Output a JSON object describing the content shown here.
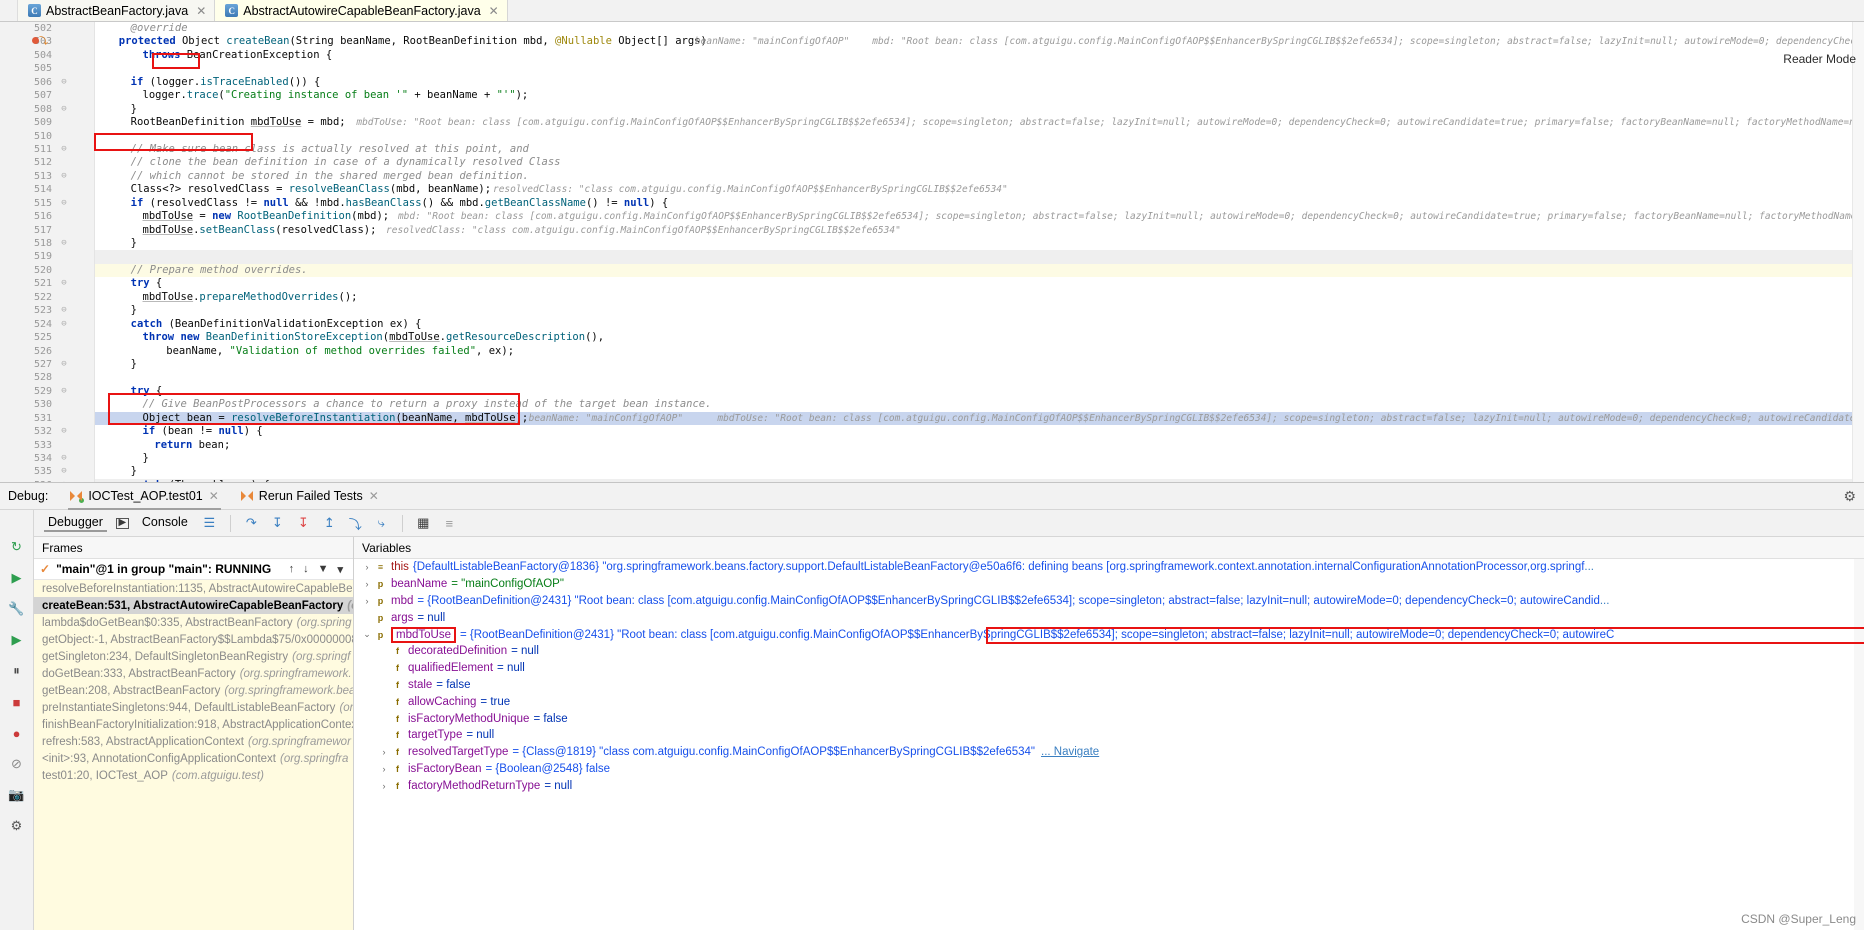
{
  "editor_tabs": [
    {
      "label": "AbstractBeanFactory.java",
      "icon": "java-class-icon",
      "active": false,
      "close": "✕"
    },
    {
      "label": "AbstractAutowireCapableBeanFactory.java",
      "icon": "java-class-icon",
      "active": true,
      "close": "✕"
    }
  ],
  "reader_mode_label": "Reader Mode",
  "code_lines": [
    {
      "num": "502",
      "indent": 6,
      "text": "@override",
      "cls": "cmt",
      "state": ""
    },
    {
      "num": "503",
      "indent": 4,
      "text": "protected Object createBean(String beanName, RootBeanDefinition mbd, @Nullable Object[] args)",
      "state": "bp",
      "inlay": "beanName: \"mainConfigOfAOP\"    mbd: \"Root bean: class [com.atguigu.config.MainConfigOfAOP$$EnhancerBySpringCGLIB$$2efe6534]; scope=singleton; abstract=false; lazyInit=null; autowireMode=0; dependencyCheck=0; autowireCandidate=true; p"
    },
    {
      "num": "504",
      "indent": 8,
      "text": "throws BeanCreationException {",
      "state": ""
    },
    {
      "num": "505",
      "indent": 0,
      "text": "",
      "state": ""
    },
    {
      "num": "506",
      "indent": 6,
      "text": "if (logger.isTraceEnabled()) {",
      "state": "fold"
    },
    {
      "num": "507",
      "indent": 8,
      "text": "logger.trace(\"Creating instance of bean '\" + beanName + \"'\");",
      "state": ""
    },
    {
      "num": "508",
      "indent": 6,
      "text": "}",
      "state": "fold"
    },
    {
      "num": "509",
      "indent": 6,
      "text": "RootBeanDefinition mbdToUse = mbd;",
      "state": "",
      "inlay": "mbdToUse: \"Root bean: class [com.atguigu.config.MainConfigOfAOP$$EnhancerBySpringCGLIB$$2efe6534]; scope=singleton; abstract=false; lazyInit=null; autowireMode=0; dependencyCheck=0; autowireCandidate=true; primary=false; factoryBeanName=null; factoryMethodName=null; initMethodName=null; destroyMethodName=null"
    },
    {
      "num": "510",
      "indent": 0,
      "text": "",
      "state": ""
    },
    {
      "num": "511",
      "indent": 6,
      "text": "// Make sure bean class is actually resolved at this point, and",
      "cls": "cmt",
      "state": "fold"
    },
    {
      "num": "512",
      "indent": 6,
      "text": "// clone the bean definition in case of a dynamically resolved Class",
      "cls": "cmt",
      "state": ""
    },
    {
      "num": "513",
      "indent": 6,
      "text": "// which cannot be stored in the shared merged bean definition.",
      "cls": "cmt",
      "state": "fold"
    },
    {
      "num": "514",
      "indent": 6,
      "text": "Class<?> resolvedClass = resolveBeanClass(mbd, beanName);",
      "state": "",
      "inlay": "resolvedClass: \"class com.atguigu.config.MainConfigOfAOP$$EnhancerBySpringCGLIB$$2efe6534\""
    },
    {
      "num": "515",
      "indent": 6,
      "text": "if (resolvedClass != null && !mbd.hasBeanClass() && mbd.getBeanClassName() != null) {",
      "state": "fold"
    },
    {
      "num": "516",
      "indent": 8,
      "text": "mbdToUse = new RootBeanDefinition(mbd);",
      "state": "",
      "inlay": "mbd: \"Root bean: class [com.atguigu.config.MainConfigOfAOP$$EnhancerBySpringCGLIB$$2efe6534]; scope=singleton; abstract=false; lazyInit=null; autowireMode=0; dependencyCheck=0; autowireCandidate=true; primary=false; factoryBeanName=null; factoryMethodName=null; initMethodName=null; destroyMethodNa"
    },
    {
      "num": "517",
      "indent": 8,
      "text": "mbdToUse.setBeanClass(resolvedClass);",
      "state": "",
      "inlay": "resolvedClass: \"class com.atguigu.config.MainConfigOfAOP$$EnhancerBySpringCGLIB$$2efe6534\""
    },
    {
      "num": "518",
      "indent": 6,
      "text": "}",
      "state": "fold"
    },
    {
      "num": "519",
      "indent": 0,
      "text": "",
      "state": "gray"
    },
    {
      "num": "520",
      "indent": 6,
      "text": "// Prepare method overrides.",
      "cls": "cmt",
      "state": "yellow"
    },
    {
      "num": "521",
      "indent": 6,
      "text": "try {",
      "state": "fold"
    },
    {
      "num": "522",
      "indent": 8,
      "text": "mbdToUse.prepareMethodOverrides();",
      "state": ""
    },
    {
      "num": "523",
      "indent": 6,
      "text": "}",
      "state": "fold"
    },
    {
      "num": "524",
      "indent": 6,
      "text": "catch (BeanDefinitionValidationException ex) {",
      "state": "fold"
    },
    {
      "num": "525",
      "indent": 8,
      "text": "throw new BeanDefinitionStoreException(mbdToUse.getResourceDescription(),",
      "state": ""
    },
    {
      "num": "526",
      "indent": 12,
      "text": "beanName, \"Validation of method overrides failed\", ex);",
      "state": ""
    },
    {
      "num": "527",
      "indent": 6,
      "text": "}",
      "state": "fold"
    },
    {
      "num": "528",
      "indent": 0,
      "text": "",
      "state": ""
    },
    {
      "num": "529",
      "indent": 6,
      "text": "try {",
      "state": "fold"
    },
    {
      "num": "530",
      "indent": 8,
      "text": "// Give BeanPostProcessors a chance to return a proxy instead of the target bean instance.",
      "cls": "cmt",
      "state": ""
    },
    {
      "num": "531",
      "indent": 8,
      "text": "Object bean = resolveBeforeInstantiation(beanName, mbdToUse);",
      "state": "exec",
      "inlay": "beanName: \"mainConfigOfAOP\"      mbdToUse: \"Root bean: class [com.atguigu.config.MainConfigOfAOP$$EnhancerBySpringCGLIB$$2efe6534]; scope=singleton; abstract=false; lazyInit=null; autowireMode=0; dependencyCheck=0; autowireCandidate=true; primary=false; factoryBeanName=null; factory"
    },
    {
      "num": "532",
      "indent": 8,
      "text": "if (bean != null) {",
      "state": "fold"
    },
    {
      "num": "533",
      "indent": 10,
      "text": "return bean;",
      "state": ""
    },
    {
      "num": "534",
      "indent": 8,
      "text": "}",
      "state": "fold"
    },
    {
      "num": "535",
      "indent": 6,
      "text": "}",
      "state": "fold"
    },
    {
      "num": "536",
      "indent": 6,
      "text": "catch (Throwable ex) {",
      "state": "gray fold"
    }
  ],
  "debug": {
    "label": "Debug:",
    "tabs": [
      {
        "label": "IOCTest_AOP.test01",
        "active": true,
        "close": "✕"
      },
      {
        "label": "Rerun Failed Tests",
        "active": false,
        "close": "✕"
      }
    ],
    "settings_icon": "gear-icon",
    "toolbar_tabs": [
      {
        "label": "Debugger",
        "active": true
      },
      {
        "label": "Console",
        "active": false
      }
    ],
    "toolbar_icons": [
      "layout-icon",
      "step-over-icon",
      "step-into-icon",
      "force-step-into-icon",
      "step-out-icon",
      "run-to-cursor-icon",
      "drop-frame-icon",
      "evaluate-expression-icon",
      "settings-view-icon"
    ],
    "left_rail_icons": [
      "rerun-icon",
      "rerun-failed-icon",
      "build-icon",
      "resume-icon",
      "pause-icon",
      "stop-icon",
      "view-breakpoints-icon",
      "mute-breakpoints-icon",
      "camera-icon",
      "settings-icon"
    ],
    "frames": {
      "title": "Frames",
      "thread": "\"main\"@1 in group \"main\": RUNNING",
      "thread_controls": [
        "up-arrow-icon",
        "down-arrow-icon",
        "filter-icon",
        "chevron-down-icon"
      ],
      "items": [
        {
          "method": "resolveBeforeInstantiation:1135, AbstractAutowireCapableBe",
          "pkg": "",
          "selected": false
        },
        {
          "method": "createBean:531, AbstractAutowireCapableBeanFactory",
          "pkg": "(org.s",
          "selected": true
        },
        {
          "method": "lambda$doGetBean$0:335, AbstractBeanFactory",
          "pkg": "(org.spring",
          "selected": false
        },
        {
          "method": "getObject:-1, AbstractBeanFactory$$Lambda$75/0x00000008",
          "pkg": "",
          "selected": false
        },
        {
          "method": "getSingleton:234, DefaultSingletonBeanRegistry",
          "pkg": "(org.springf",
          "selected": false
        },
        {
          "method": "doGetBean:333, AbstractBeanFactory",
          "pkg": "(org.springframework.",
          "selected": false
        },
        {
          "method": "getBean:208, AbstractBeanFactory",
          "pkg": "(org.springframework.bea",
          "selected": false
        },
        {
          "method": "preInstantiateSingletons:944, DefaultListableBeanFactory",
          "pkg": "(org",
          "selected": false
        },
        {
          "method": "finishBeanFactoryInitialization:918, AbstractApplicationContex",
          "pkg": "",
          "selected": false
        },
        {
          "method": "refresh:583, AbstractApplicationContext",
          "pkg": "(org.springframewor",
          "selected": false
        },
        {
          "method": "<init>:93, AnnotationConfigApplicationContext",
          "pkg": "(org.springfra",
          "selected": false
        },
        {
          "method": "test01:20, IOCTest_AOP",
          "pkg": "(com.atguigu.test)",
          "selected": false
        }
      ]
    },
    "variables": {
      "title": "Variables",
      "items": [
        {
          "depth": 0,
          "arrow": "›",
          "icon": "p",
          "icon_glyph": "≡",
          "name": "this",
          "name_red": true,
          "value": "{DefaultListableBeanFactory@1836} \"org.springframework.beans.factory.support.DefaultListableBeanFactory@e50a6f6: defining beans [org.springframework.context.annotation.internalConfigurationAnnotationProcessor,org.springf",
          "trailing": "...",
          "boxed": false
        },
        {
          "depth": 0,
          "arrow": "›",
          "icon": "p",
          "icon_glyph": "p",
          "name": "beanName",
          "value": "= \"mainConfigOfAOP\"",
          "boxed": false,
          "is_string": true
        },
        {
          "depth": 0,
          "arrow": "›",
          "icon": "p",
          "icon_glyph": "p",
          "name": "mbd",
          "value": "= {RootBeanDefinition@2431} \"Root bean: class [com.atguigu.config.MainConfigOfAOP$$EnhancerBySpringCGLIB$$2efe6534]; scope=singleton; abstract=false; lazyInit=null; autowireMode=0; dependencyCheck=0; autowireCandid",
          "trailing": "...",
          "boxed": false
        },
        {
          "depth": 0,
          "arrow": "",
          "icon": "p",
          "icon_glyph": "p",
          "name": "args",
          "value": "= null",
          "boxed": false,
          "is_null": true
        },
        {
          "depth": 0,
          "arrow": "⌄",
          "icon": "p",
          "icon_glyph": "p",
          "name": "mbdToUse",
          "name_boxed": true,
          "value": "= {RootBeanDefinition@2431} \"Root bean: class [com.atguigu.config.MainConfigOfAOP$$EnhancerBySpringCGLIB$$2efe6534]; scope=singleton; abstract=false; lazyInit=null; autowireMode=0; dependencyCheck=0; autowireC",
          "boxed": true
        },
        {
          "depth": 1,
          "arrow": "",
          "icon": "f",
          "icon_glyph": "f",
          "name": "decoratedDefinition",
          "value": "= null",
          "is_null": true
        },
        {
          "depth": 1,
          "arrow": "",
          "icon": "f",
          "icon_glyph": "f",
          "name": "qualifiedElement",
          "value": "= null",
          "is_null": true
        },
        {
          "depth": 1,
          "arrow": "",
          "icon": "f",
          "icon_glyph": "f",
          "name": "stale",
          "value": "= false",
          "is_bool": true
        },
        {
          "depth": 1,
          "arrow": "",
          "icon": "f",
          "icon_glyph": "f",
          "name": "allowCaching",
          "value": "= true",
          "is_bool": true
        },
        {
          "depth": 1,
          "arrow": "",
          "icon": "f",
          "icon_glyph": "f",
          "name": "isFactoryMethodUnique",
          "value": "= false",
          "is_bool": true
        },
        {
          "depth": 1,
          "arrow": "",
          "icon": "f",
          "icon_glyph": "f",
          "name": "targetType",
          "value": "= null",
          "is_null": true
        },
        {
          "depth": 1,
          "arrow": "›",
          "icon": "f",
          "icon_glyph": "f",
          "name": "resolvedTargetType",
          "value": "= {Class@1819} \"class com.atguigu.config.MainConfigOfAOP$$EnhancerBySpringCGLIB$$2efe6534\"",
          "nav": "... Navigate"
        },
        {
          "depth": 1,
          "arrow": "›",
          "icon": "f",
          "icon_glyph": "f",
          "name": "isFactoryBean",
          "value": "= {Boolean@2548} false"
        },
        {
          "depth": 1,
          "arrow": "›",
          "icon": "f",
          "icon_glyph": "f",
          "name": "factoryMethodReturnType",
          "value": "= null",
          "is_null": true
        }
      ]
    }
  },
  "watermark": "CSDN @Super_Leng",
  "colors": {
    "accent_red": "#e81313",
    "exec_line": "#c8d5ee",
    "tab_active": "#ffffea",
    "frames_bg": "#fffbe0"
  }
}
